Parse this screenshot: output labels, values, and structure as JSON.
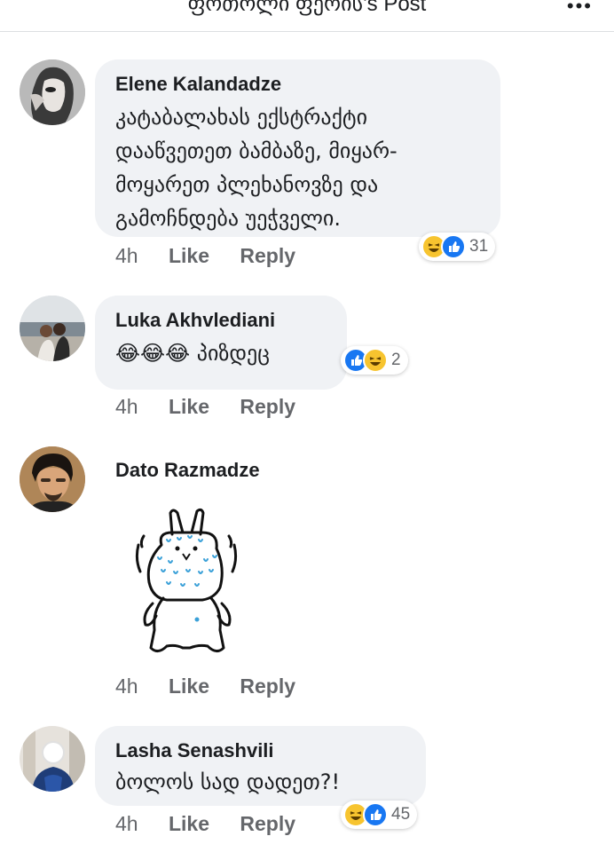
{
  "header": {
    "title": "ფოთოლი ფერის's Post",
    "back_icon": "chevron-left-icon",
    "more_icon": "ellipsis-icon"
  },
  "colors": {
    "bubble": "#f0f2f5",
    "like_blue": "#1877f2",
    "haha_yellow": "#f7c42f",
    "meta_gray": "#65676b"
  },
  "comments": [
    {
      "author": "Elene Kalandadze",
      "text": "კატაბალახას ექსტრაქტი\nდააწვეთეთ ბამბაზე, მიყარ-\nმოყარეთ პლეხანოვზე და\nგამოჩნდება უეჭველი.",
      "time": "4h",
      "like_label": "Like",
      "reply_label": "Reply",
      "reactions": [
        "haha",
        "like"
      ],
      "reaction_count": "31"
    },
    {
      "author": "Luka Akhvlediani",
      "text": "😂😂😂 პიზდეც",
      "time": "4h",
      "like_label": "Like",
      "reply_label": "Reply",
      "reactions": [
        "like",
        "haha"
      ],
      "reaction_count": "2"
    },
    {
      "author": "Dato Razmadze",
      "sticker": "sweating-bunny-sticker",
      "time": "4h",
      "like_label": "Like",
      "reply_label": "Reply"
    },
    {
      "author": "Lasha Senashvili",
      "text": "ბოლოს სად დადეთ?!",
      "time": "4h",
      "like_label": "Like",
      "reply_label": "Reply",
      "reactions": [
        "haha",
        "like"
      ],
      "reaction_count": "45"
    }
  ]
}
